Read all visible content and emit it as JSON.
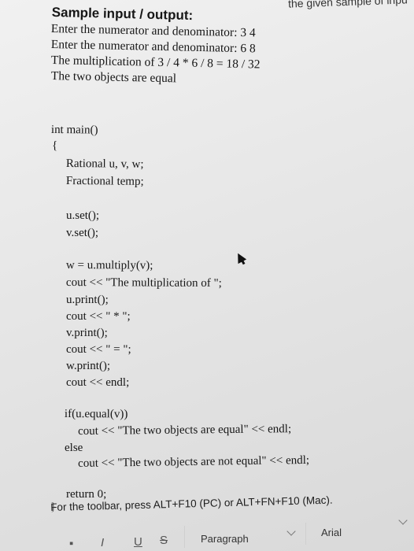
{
  "header": {
    "cut_off_text": "the given sample of inpu",
    "title": "Sample input / output:"
  },
  "sample_lines": [
    "Enter the numerator and denominator: 3 4",
    "Enter the numerator and denominator: 6 8",
    "The multiplication of 3 / 4 * 6 / 8 = 18 / 32",
    "The two objects are equal"
  ],
  "code_lines": [
    "int main()",
    "{",
    "Rational u, v, w;",
    "Fractional temp;",
    "u.set();",
    "v.set();",
    "w = u.multiply(v);",
    "cout << \"The multiplication of \";",
    "u.print();",
    "cout << \" * \";",
    "v.print();",
    "cout << \" = \";",
    "w.print();",
    "cout << endl;",
    "if(u.equal(v))",
    "cout << \"The two objects are equal\" << endl;",
    "else",
    "cout << \"The two objects are not equal\" << endl;",
    "return 0;",
    "}"
  ],
  "toolbar_note": "For the toolbar, press ALT+F10 (PC) or ALT+FN+F10 (Mac).",
  "toolbar": {
    "italic_label": "I",
    "underline_label": "U",
    "strike_label": "S",
    "paragraph_label": "Paragraph",
    "font_label": "Arial"
  }
}
